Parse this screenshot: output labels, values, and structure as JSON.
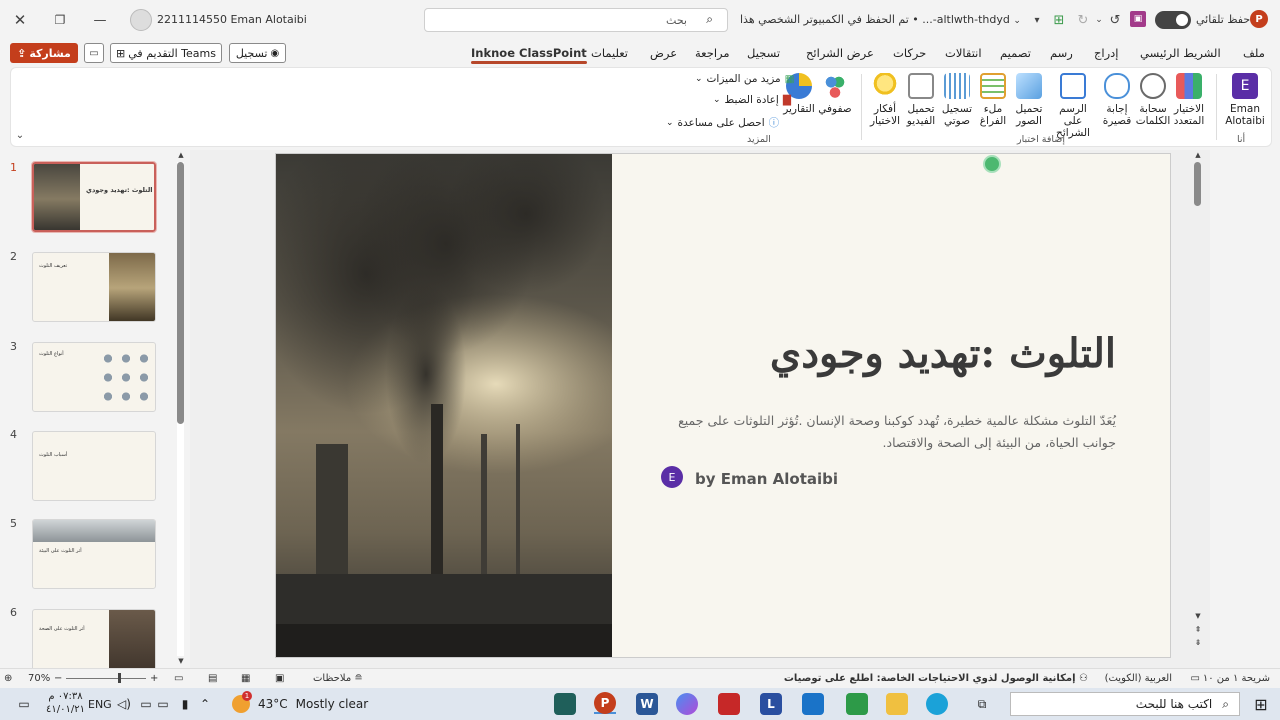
{
  "titlebar": {
    "autosave_label": "حفظ تلقائي",
    "doc_title": "altlwth-thdyd-... • تم الحفظ في الكمبيوتر الشخصي هذا",
    "search_placeholder": "بحث",
    "user": "2211114550 Eman Alotaibi"
  },
  "tabs": [
    "ملف",
    "الشريط الرئيسي",
    "إدراج",
    "رسم",
    "تصميم",
    "انتقالات",
    "حركات",
    "عرض الشرائح",
    "تسجيل",
    "مراجعة",
    "عرض",
    "تعليمات",
    "Inknoe ClassPoint"
  ],
  "active_tab": "Inknoe ClassPoint",
  "actions": {
    "share": "مشاركة",
    "present_teams": "التقديم في Teams",
    "record": "تسجيل"
  },
  "ribbon": {
    "user_btn": {
      "initial": "E",
      "label": "Eman Alotaibi",
      "group": "أنا"
    },
    "quiz_group_label": "إضافة اختبار",
    "quiz_buttons": [
      {
        "label": "الاختيار المتعدد",
        "icon": "multiple-choice-icon",
        "color": "#5b7be0"
      },
      {
        "label": "سحابة الكلمات",
        "icon": "word-cloud-icon",
        "color": "#6a6a6a"
      },
      {
        "label": "إجابة قصيرة",
        "icon": "short-answer-icon",
        "color": "#4a90d9"
      },
      {
        "label": "الرسم على الشرائح",
        "icon": "slide-drawing-icon",
        "color": "#3a7bd5"
      },
      {
        "label": "تحميل الصور",
        "icon": "image-upload-icon",
        "color": "#5aa0e0"
      },
      {
        "label": "ملء الفراغ",
        "icon": "fill-blank-icon",
        "color": "#e0a030"
      },
      {
        "label": "تسجيل صوتي",
        "icon": "audio-record-icon",
        "color": "#5b9bd5"
      },
      {
        "label": "تحميل الفيديو",
        "icon": "video-upload-icon",
        "color": "#d9534f"
      },
      {
        "label": "أفكار الاختيار",
        "icon": "lightbulb-icon",
        "color": "#f0c020"
      }
    ],
    "more_group_label": "المزيد",
    "more_buttons": [
      {
        "label": "صفوفي",
        "icon": "my-classes-icon",
        "color": "#4a90d9"
      },
      {
        "label": "التقارير",
        "icon": "reports-icon",
        "color": "#3a7bd5"
      }
    ],
    "more_small": [
      {
        "label": "مزيد من الميزات",
        "icon": "features-grid-icon",
        "color": "#3aa35a"
      },
      {
        "label": "إعادة الضبط",
        "icon": "trash-icon",
        "color": "#c0392b"
      },
      {
        "label": "احصل على مساعدة",
        "icon": "info-icon",
        "color": "#4a90d9"
      }
    ]
  },
  "thumbnails": [
    {
      "num": "1",
      "title": "التلوث :تهديد وجودي",
      "selected": true
    },
    {
      "num": "2",
      "title": "تعريف التلوث",
      "selected": false
    },
    {
      "num": "3",
      "title": "أنواع التلوث",
      "selected": false
    },
    {
      "num": "4",
      "title": "أسباب التلوث",
      "selected": false
    },
    {
      "num": "5",
      "title": "أثر التلوث على البيئة",
      "selected": false
    },
    {
      "num": "6",
      "title": "أثر التلوث على الصحة",
      "selected": false
    }
  ],
  "slide": {
    "title": "التلوث :تهديد وجودي",
    "body": "يُعَدّ التلوث مشكلة عالمية خطيرة، تُهدد كوكبنا وصحة الإنسان .تُؤثر التلوثات على جميع جوانب الحياة، من البيئة إلى الصحة والاقتصاد.",
    "author_initial": "E",
    "author": "by Eman Alotaibi"
  },
  "statusbar": {
    "slide_count": "شريحة ١ من ١٠",
    "language": "العربية (الكويت)",
    "accessibility": "إمكانية الوصول لذوي الاحتياجات الخاصة: اطلع على توصيات",
    "notes": "ملاحظات",
    "zoom": "70%"
  },
  "taskbar": {
    "search_placeholder": "اكتب هنا للبحث",
    "weather_temp": "43°C",
    "weather_text": "Mostly clear",
    "lang": "ENG",
    "time": "٠٧:٣٨ م",
    "date": "٤١/٠١/٢١",
    "notif_badge": "1"
  },
  "colors": {
    "accent": "#c43e1c",
    "classpoint_purple": "#5a2ea6"
  }
}
